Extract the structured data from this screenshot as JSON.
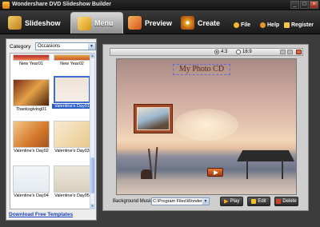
{
  "window": {
    "title": "Wondershare DVD Slideshow Builder",
    "min": "_",
    "max": "□",
    "close": "×"
  },
  "toolbar": {
    "tabs": [
      {
        "label": "Slideshow",
        "icon": "slideshow-icon"
      },
      {
        "label": "Menu",
        "icon": "menu-icon",
        "active": true
      },
      {
        "label": "Preview",
        "icon": "preview-icon"
      },
      {
        "label": "Create",
        "icon": "disc-icon"
      }
    ],
    "links": {
      "file": "File",
      "help": "Help",
      "register": "Register"
    }
  },
  "left": {
    "category_label": "Category",
    "category_value": "Occasions",
    "thumbnails": [
      {
        "label": "New Year01"
      },
      {
        "label": "New Year02"
      },
      {
        "label": "Thanksgiving01"
      },
      {
        "label": "Valentine's Day01",
        "selected": true
      },
      {
        "label": "Valentine's Day02"
      },
      {
        "label": "Valentine's Day03"
      },
      {
        "label": "Valentine's Day04"
      },
      {
        "label": "Valentine's Day05"
      }
    ],
    "download_link": "Download Free Templates"
  },
  "right": {
    "ratio_43": "4:3",
    "ratio_169": "16:9",
    "preview_title": "My Photo CD",
    "bg_music_label": "Background Music:",
    "bg_music_value": "C:\\Program Files\\Wondersha",
    "buttons": {
      "play": "Play",
      "edit": "Edit",
      "delete": "Delete"
    }
  },
  "colors": {
    "accent": "#2d5fc3",
    "link": "#1a3fbf",
    "frame": "#a04a2a"
  }
}
